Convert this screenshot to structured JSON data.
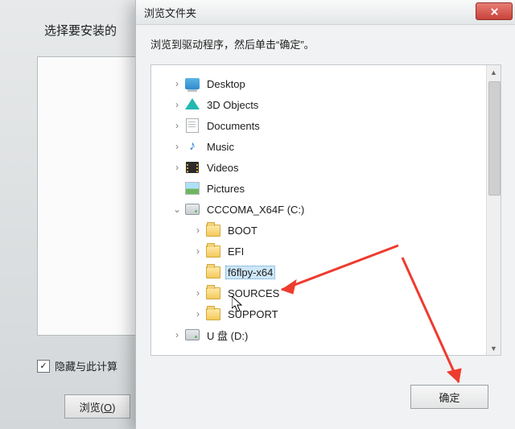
{
  "back": {
    "title_partial": "选择要安装的",
    "checkbox_label": "隐藏与此计算",
    "checkbox_checked": true,
    "browse_label": "浏览(",
    "browse_key": "O",
    "browse_label_close": ")"
  },
  "dialog": {
    "title": "浏览文件夹",
    "close_icon": "close-icon",
    "instruction": "浏览到驱动程序，然后单击“确定”。",
    "ok_label": "确定"
  },
  "tree": [
    {
      "level": 0,
      "expander": "collapsed",
      "icon": "desktop",
      "label": "Desktop"
    },
    {
      "level": 0,
      "expander": "collapsed",
      "icon": "3d",
      "label": "3D Objects"
    },
    {
      "level": 0,
      "expander": "collapsed",
      "icon": "doc",
      "label": "Documents"
    },
    {
      "level": 0,
      "expander": "collapsed",
      "icon": "music",
      "label": "Music"
    },
    {
      "level": 0,
      "expander": "collapsed",
      "icon": "video",
      "label": "Videos"
    },
    {
      "level": 0,
      "expander": "none",
      "icon": "pic",
      "label": "Pictures"
    },
    {
      "level": 0,
      "expander": "expanded",
      "icon": "drive",
      "label": "CCCOMA_X64F (C:)"
    },
    {
      "level": 1,
      "expander": "collapsed",
      "icon": "folder",
      "label": "BOOT"
    },
    {
      "level": 1,
      "expander": "collapsed",
      "icon": "folder",
      "label": "EFI"
    },
    {
      "level": 1,
      "expander": "none",
      "icon": "folder",
      "label": "f6flpy-x64",
      "selected": true,
      "cursor": true
    },
    {
      "level": 1,
      "expander": "collapsed",
      "icon": "folder",
      "label": "SOURCES"
    },
    {
      "level": 1,
      "expander": "collapsed",
      "icon": "folder",
      "label": "SUPPORT"
    },
    {
      "level": 0,
      "expander": "collapsed",
      "icon": "drive",
      "label": "U 盘 (D:)"
    }
  ]
}
